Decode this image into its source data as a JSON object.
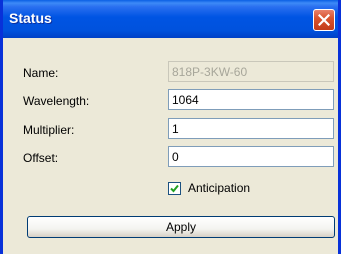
{
  "window": {
    "title": "Status"
  },
  "form": {
    "name_label": "Name:",
    "name_value": "818P-3KW-60",
    "wavelength_label": "Wavelength:",
    "wavelength_value": "1064",
    "multiplier_label": "Multiplier:",
    "multiplier_value": "1",
    "offset_label": "Offset:",
    "offset_value": "0",
    "anticipation_label": "Anticipation",
    "anticipation_checked": true
  },
  "buttons": {
    "apply_label": "Apply"
  },
  "colors": {
    "titlebar": "#0054e3",
    "close": "#d9542e",
    "face": "#ece9d8"
  },
  "icons": {
    "close": "close-icon",
    "check": "checkmark-icon"
  }
}
